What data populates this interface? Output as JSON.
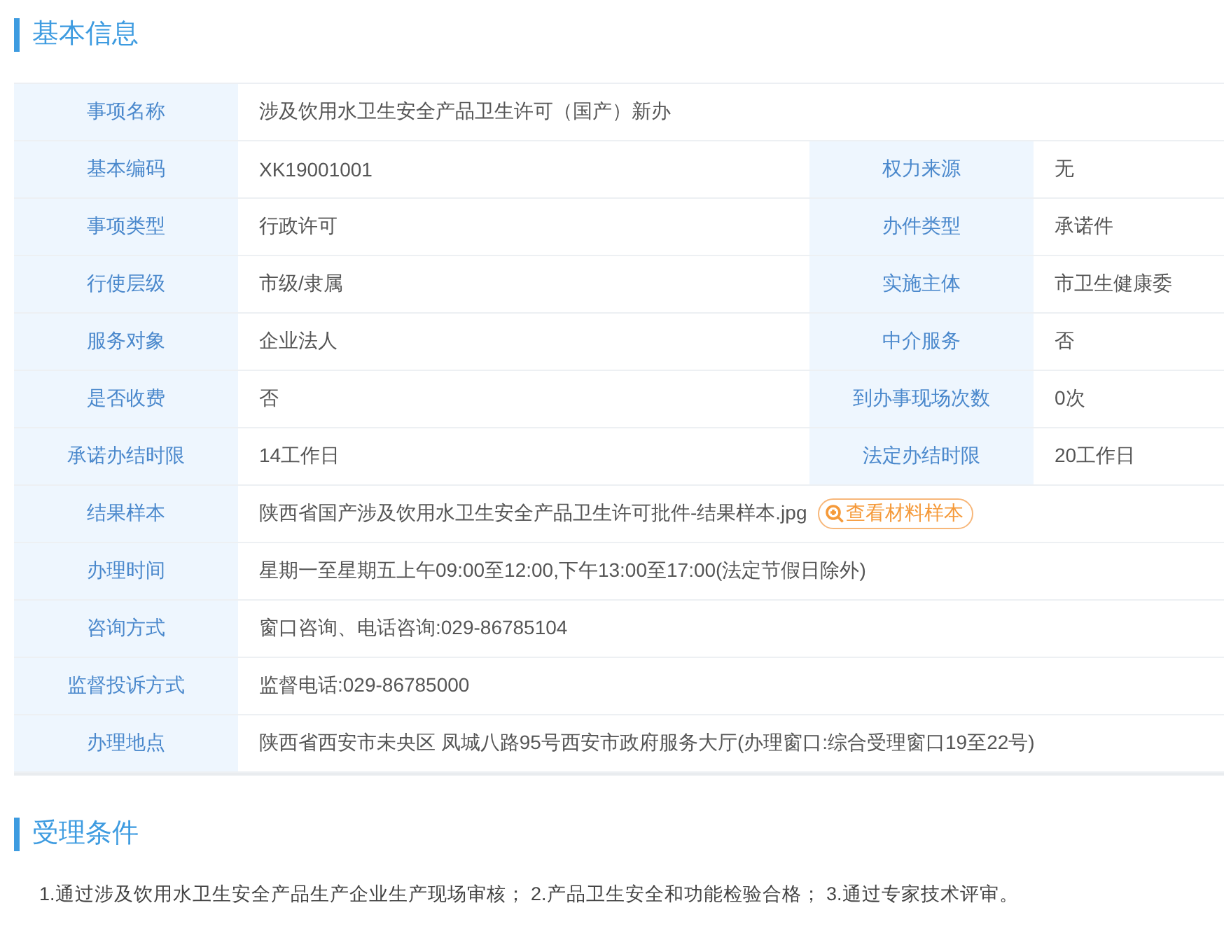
{
  "sections": [
    {
      "title": "基本信息",
      "kind": "table",
      "rows": [
        {
          "kind": "single",
          "label": "事项名称",
          "value": "涉及饮用水卫生安全产品卫生许可（国产）新办"
        },
        {
          "kind": "pair",
          "label": "基本编码",
          "value": "XK19001001",
          "label_2": "权力来源",
          "value_2": "无"
        },
        {
          "kind": "pair",
          "label": "事项类型",
          "value": "行政许可",
          "label_2": "办件类型",
          "value_2": "承诺件"
        },
        {
          "kind": "pair",
          "label": "行使层级",
          "value": "市级/隶属",
          "label_2": "实施主体",
          "value_2": "市卫生健康委"
        },
        {
          "kind": "pair",
          "label": "服务对象",
          "value": "企业法人",
          "label_2": "中介服务",
          "value_2": "否"
        },
        {
          "kind": "pair",
          "label": "是否收费",
          "value": "否",
          "label_2": "到办事现场次数",
          "value_2": "0次"
        },
        {
          "kind": "pair",
          "label": "承诺办结时限",
          "value": "14工作日",
          "label_2": "法定办结时限",
          "value_2": "20工作日"
        },
        {
          "kind": "sample",
          "label": "结果样本",
          "value": "陕西省国产涉及饮用水卫生安全产品卫生许可批件-结果样本.jpg",
          "action": "查看材料样本"
        },
        {
          "kind": "single",
          "label": "办理时间",
          "value": "星期一至星期五上午09:00至12:00,下午13:00至17:00(法定节假日除外)"
        },
        {
          "kind": "single",
          "label": "咨询方式",
          "value": "窗口咨询、电话咨询:029-86785104"
        },
        {
          "kind": "single",
          "label": "监督投诉方式",
          "value": "监督电话:029-86785000"
        },
        {
          "kind": "single",
          "label": "办理地点",
          "value": "陕西省西安市未央区 凤城八路95号西安市政府服务大厅(办理窗口:综合受理窗口19至22号)"
        }
      ]
    },
    {
      "title": "受理条件",
      "kind": "text",
      "text": "1.通过涉及饮用水卫生安全产品生产企业生产现场审核； 2.产品卫生安全和功能检验合格； 3.通过专家技术评审。"
    }
  ]
}
